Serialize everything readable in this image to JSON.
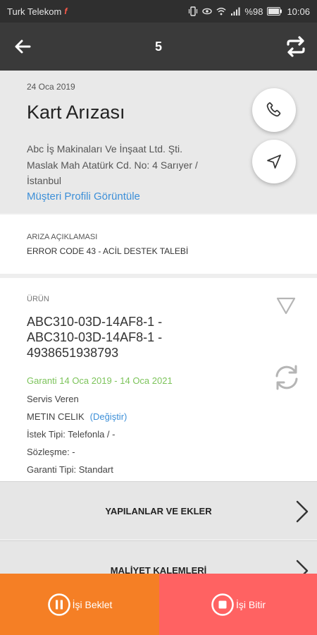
{
  "status_bar": {
    "carrier": "Turk Telekom",
    "carrier_mark": "f",
    "battery": "%98",
    "time": "10:06"
  },
  "app_bar": {
    "title": "5",
    "back_icon": "arrow-left-icon",
    "action_icon": "swap-icon"
  },
  "header": {
    "date": "24 Oca 2019",
    "title": "Kart Arızası",
    "company": "Abc İş Makinaları Ve İnşaat Ltd. Şti.",
    "address_line1": "Maslak Mah Atatürk  Cd. No: 4 Sarıyer /",
    "address_line2": "İstanbul",
    "profile_link": "Müşteri Profili Görüntüle"
  },
  "fault": {
    "label": "ARIZA AÇIKLAMASI",
    "value": "ERROR CODE 43 - ACİL DESTEK TALEBİ"
  },
  "product": {
    "label": "ÜRÜN",
    "code_line1": "ABC310-03D-14AF8-1 -",
    "code_line2": "ABC310-03D-14AF8-1 -",
    "code_line3": "4938651938793",
    "warranty": "Garanti 14 Oca 2019 - 14 Oca 2021",
    "service_label": "Servis Veren",
    "technician": "METIN CELIK",
    "change_link": "(Değiştir)",
    "request_type": "İstek Tipi: Telefonla / -",
    "contract": "Sözleşme:  -",
    "warranty_type": "Garanti Tipi: Standart"
  },
  "sections": [
    {
      "label": "YAPILANLAR VE EKLER"
    },
    {
      "label": "MALİYET KALEMLERİ"
    }
  ],
  "bottom": {
    "pause_label": "İşi Beklet",
    "finish_label": "İşi Bitir"
  },
  "colors": {
    "app_bar": "#3a3a3a",
    "link": "#3c8fd8",
    "warranty": "#7cc35a",
    "pause": "#f57f25",
    "finish": "#ff6262"
  }
}
